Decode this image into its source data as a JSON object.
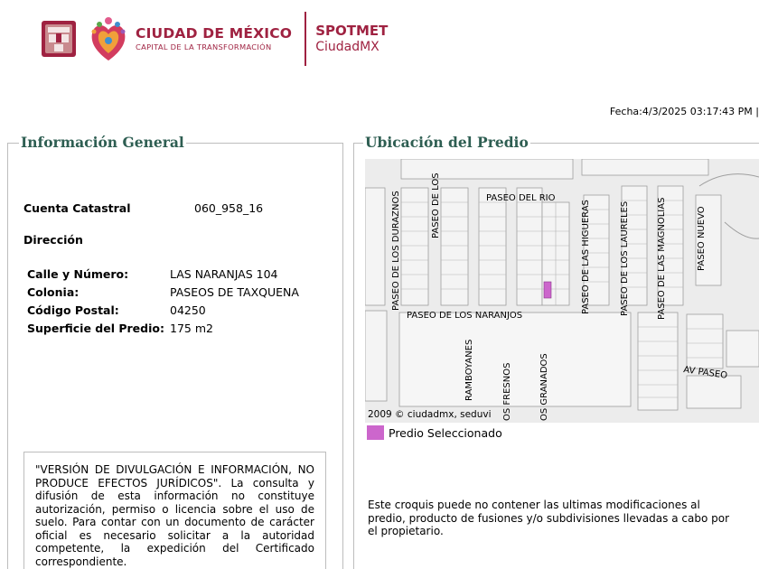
{
  "header": {
    "brand_title": "CIUDAD DE MÉXICO",
    "brand_subtitle": "CAPITAL DE LA TRANSFORMACIÓN",
    "app_title": "SPOTMET",
    "app_subtitle": "CiudadMX",
    "brand_color": "#9f2241"
  },
  "date_line": "Fecha:4/3/2025 03:17:43 PM |",
  "info": {
    "legend": "Información General",
    "cuenta_label": "Cuenta Catastral",
    "cuenta_value": "060_958_16",
    "direccion_label": "Dirección",
    "fields": [
      {
        "label": "Calle y Número:",
        "value": "LAS NARANJAS 104"
      },
      {
        "label": "Colonia:",
        "value": "PASEOS DE TAXQUENA"
      },
      {
        "label": "Código Postal:",
        "value": "04250"
      },
      {
        "label": "Superficie del Predio:",
        "value": "175 m2"
      }
    ],
    "notice": "\"VERSIÓN DE DIVULGACIÓN E INFORMACIÓN, NO PRODUCE EFECTOS JURÍDICOS\". La consulta y difusión de esta información no constituye autorización, permiso o licencia sobre el uso de suelo. Para contar con un documento de carácter oficial es necesario solicitar a la autoridad competente, la expedición del Certificado correspondiente."
  },
  "location": {
    "legend": "Ubicación del Predio",
    "streets": {
      "duraznos": "PASEO DE LOS DURAZNOS",
      "los_top": "PASEO DE LOS",
      "rio": "PASEO DEL RIO",
      "higueras": "PASEO DE LAS HIGUERAS",
      "laureles": "PASEO DE LOS LAURELES",
      "magnolias": "PASEO DE LAS MAGNOLIAS",
      "nuevo": "PASEO NUEVO",
      "naranjos": "PASEO DE LOS NARANJOS",
      "framboyanes": "RAMBOYANES",
      "fresnos": "OS FRESNOS",
      "granados": "OS GRANADOS",
      "av_paseo": "AV PASEO"
    },
    "credit": "2009 © ciudadmx, seduvi",
    "legend_key": "Predio Seleccionado",
    "highlight_color": "#cc66cc",
    "note": "Este croquis puede no contener las ultimas modificaciones al predio, producto de fusiones y/o subdivisiones llevadas a cabo por el propietario."
  }
}
